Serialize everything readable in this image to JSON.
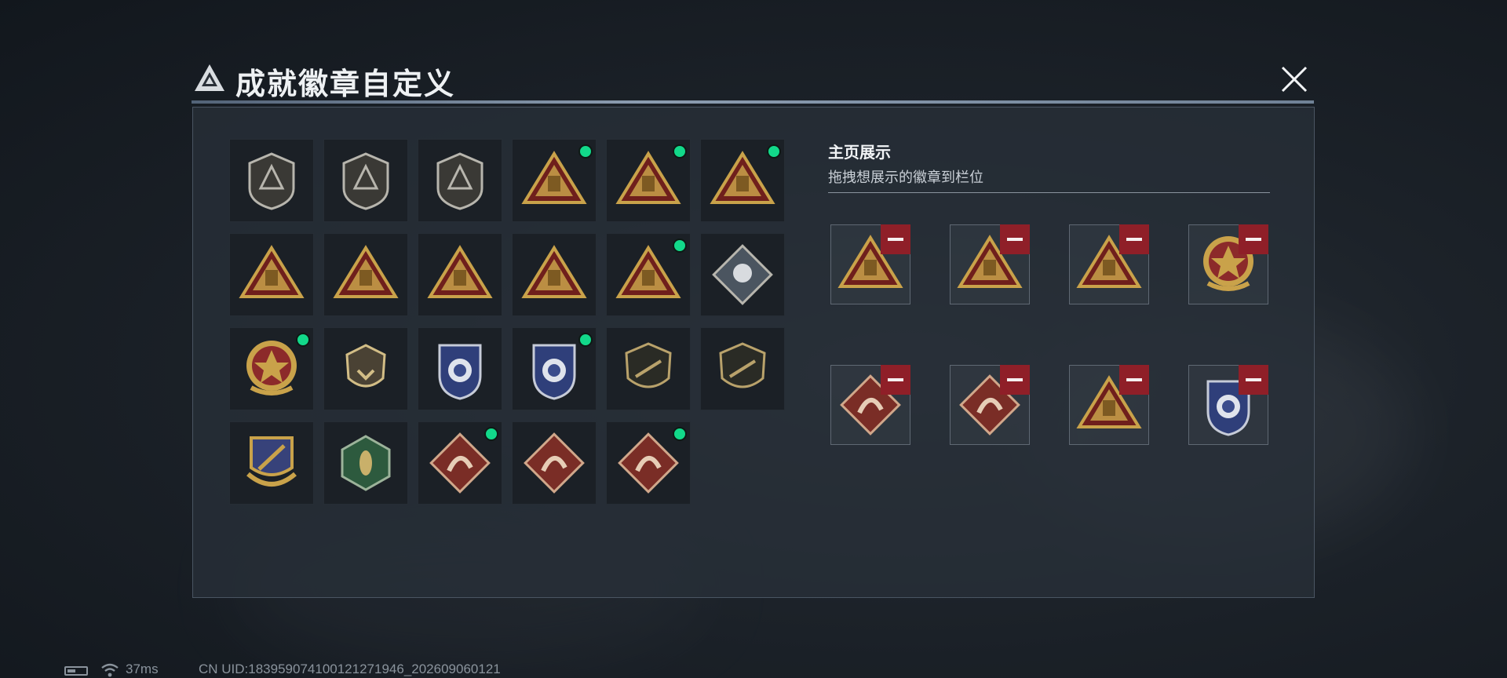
{
  "header": {
    "title": "成就徽章自定义",
    "logo_icon": "delta-logo-icon",
    "close_icon": "close-icon"
  },
  "badge_grid": [
    {
      "icon": "delta-shield-badge-icon",
      "tier": "silver-shield",
      "has_new": false
    },
    {
      "icon": "helicopter-shield-badge-icon",
      "tier": "silver-shield",
      "has_new": false
    },
    {
      "icon": "emblem-shield-badge-icon",
      "tier": "silver-shield",
      "has_new": false
    },
    {
      "icon": "lantern-57-badge-icon",
      "tier": "gold-triangle",
      "has_new": true
    },
    {
      "icon": "tower-59-badge-icon",
      "tier": "gold-triangle",
      "has_new": true
    },
    {
      "icon": "explosion-s18-badge-icon",
      "tier": "gold-triangle",
      "has_new": true
    },
    {
      "icon": "boat-badge-icon",
      "tier": "gold-triangle",
      "has_new": false
    },
    {
      "icon": "number-1-badge-icon",
      "tier": "gold-triangle",
      "has_new": false
    },
    {
      "icon": "number-2-badge-icon",
      "tier": "gold-triangle",
      "has_new": false
    },
    {
      "icon": "soldiers-badge-icon",
      "tier": "gold-triangle",
      "has_new": false
    },
    {
      "icon": "rocket-badge-icon",
      "tier": "gold-triangle",
      "has_new": true
    },
    {
      "icon": "rose-diamond-badge-icon",
      "tier": "silver-diamond",
      "has_new": false
    },
    {
      "icon": "star-medal-badge-icon",
      "tier": "medal",
      "has_new": true
    },
    {
      "icon": "shield-emblem-badge-icon",
      "tier": "gold-shield",
      "has_new": false
    },
    {
      "icon": "blue-shield-badge-icon",
      "tier": "blue-shield",
      "has_new": false
    },
    {
      "icon": "blue-gem-shield-badge-icon",
      "tier": "blue-shield",
      "has_new": true
    },
    {
      "icon": "rifle-shield-badge-icon",
      "tier": "dark-shield",
      "has_new": false
    },
    {
      "icon": "smg-shield-badge-icon",
      "tier": "dark-shield",
      "has_new": false
    },
    {
      "icon": "crossed-swords-badge-icon",
      "tier": "blue-crest",
      "has_new": false
    },
    {
      "icon": "wasp-hexagon-badge-icon",
      "tier": "green-hex",
      "has_new": false
    },
    {
      "icon": "dragon-diamond-badge-icon",
      "tier": "red-diamond",
      "has_new": true
    },
    {
      "icon": "dragon-diamond-badge-icon",
      "tier": "red-diamond",
      "has_new": false
    },
    {
      "icon": "runner-diamond-badge-icon",
      "tier": "red-diamond",
      "has_new": true
    }
  ],
  "showcase": {
    "title": "主页展示",
    "subtitle": "拖拽想展示的徽章到栏位",
    "slots": [
      {
        "icon": "explosion-s18-badge-icon",
        "tier": "gold-triangle"
      },
      {
        "icon": "tower-59-badge-icon",
        "tier": "gold-triangle"
      },
      {
        "icon": "lantern-57-badge-icon",
        "tier": "gold-triangle"
      },
      {
        "icon": "star-medal-badge-icon",
        "tier": "medal"
      },
      {
        "icon": "runner-diamond-badge-icon",
        "tier": "red-diamond"
      },
      {
        "icon": "dragon-diamond-badge-icon",
        "tier": "red-diamond"
      },
      {
        "icon": "rocket-badge-icon",
        "tier": "gold-triangle"
      },
      {
        "icon": "blue-gem-shield-badge-icon",
        "tier": "blue-shield"
      }
    ],
    "remove_icon": "minus-icon"
  },
  "status_bar": {
    "ping": "37ms",
    "uid": "CN UID:18395907410012127194​6_202609060121",
    "battery_icon": "battery-icon",
    "wifi_icon": "wifi-icon"
  },
  "colors": {
    "new_dot": "#12d98a",
    "remove": "#8f1f28",
    "gold": "#c9a24a",
    "silver": "#b7b5ad"
  }
}
